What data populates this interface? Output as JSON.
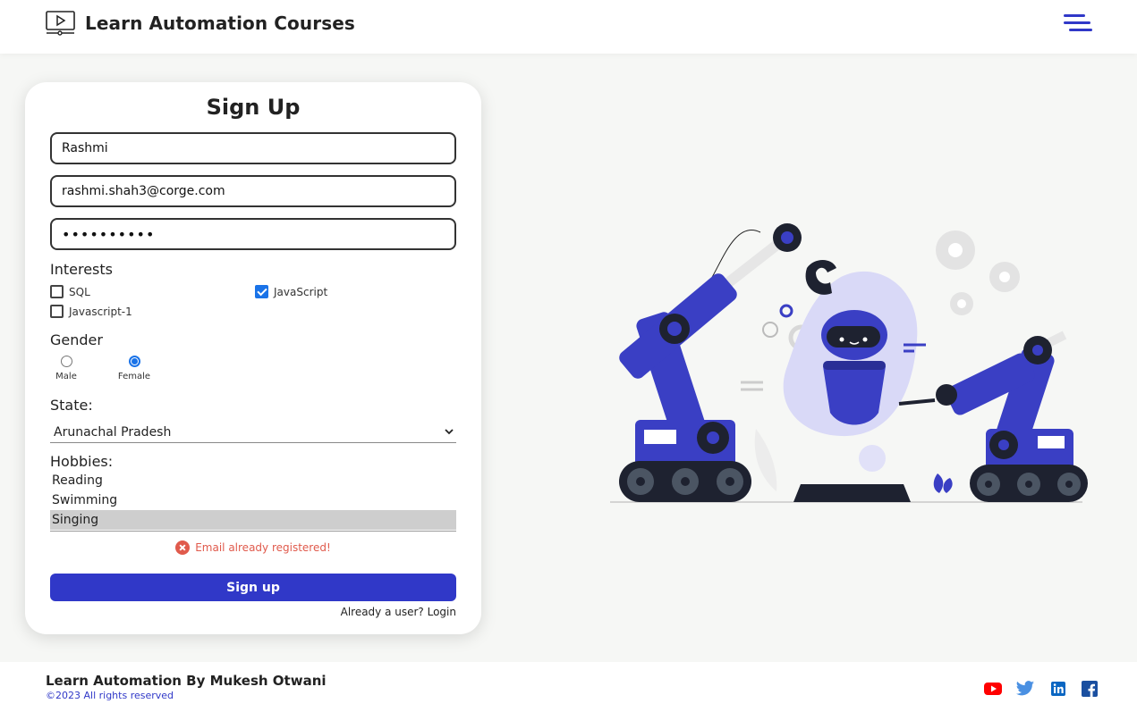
{
  "header": {
    "title": "Learn Automation Courses"
  },
  "form": {
    "title": "Sign Up",
    "name_value": "Rashmi",
    "email_value": "rashmi.shah3@corge.com",
    "password_value": "rashmi1234",
    "interests_label": "Interests",
    "interests": [
      {
        "label": "SQL",
        "checked": false
      },
      {
        "label": "JavaScript",
        "checked": true
      },
      {
        "label": "Javascript-1",
        "checked": false
      }
    ],
    "gender_label": "Gender",
    "genders": [
      {
        "label": "Male",
        "selected": false
      },
      {
        "label": "Female",
        "selected": true
      }
    ],
    "state_label": "State:",
    "state_value": "Arunachal Pradesh",
    "hobbies_label": "Hobbies:",
    "hobbies": [
      {
        "label": "Reading",
        "selected": false
      },
      {
        "label": "Swimming",
        "selected": false
      },
      {
        "label": "Singing",
        "selected": true
      }
    ],
    "error_text": "Email already registered!",
    "submit_label": "Sign up",
    "login_text": "Already a user? Login"
  },
  "footer": {
    "title": "Learn Automation By Mukesh Otwani",
    "copyright": "©2023 All rights reserved",
    "social": [
      "youtube-icon",
      "twitter-icon",
      "linkedin-icon",
      "facebook-icon"
    ]
  },
  "colors": {
    "accent": "#3038c8",
    "error": "#e05a4c",
    "checkbox": "#1a73e8"
  }
}
